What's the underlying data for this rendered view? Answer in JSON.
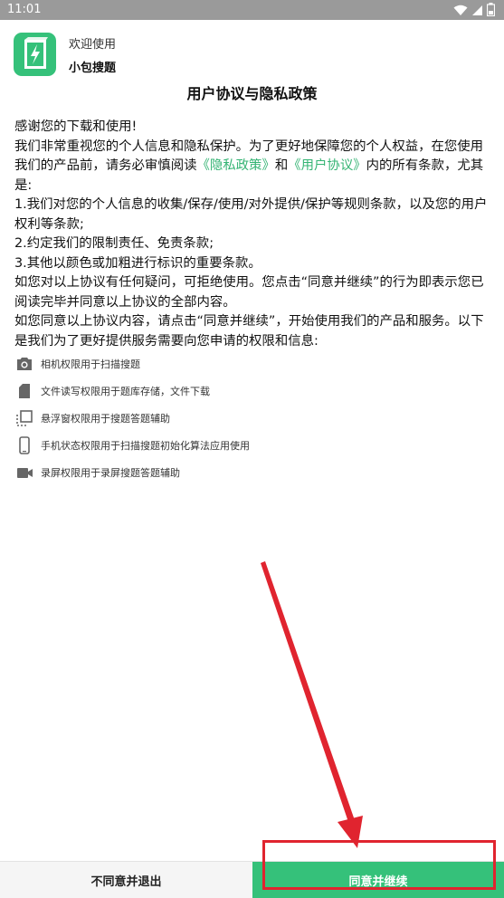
{
  "status_bar": {
    "time": "11:01",
    "icons": [
      "wifi-icon",
      "signal-icon",
      "battery-icon"
    ]
  },
  "header": {
    "welcome": "欢迎使用",
    "app_name": "小包搜题",
    "logo_icon": "book-lightning-logo"
  },
  "dialog": {
    "title": "用户协议与隐私政策",
    "para1": "感谢您的下载和使用!",
    "para2_pre": "我们非常重视您的个人信息和隐私保护。为了更好地保障您的个人权益，在您使用我们的产品前，请务必审慎阅读",
    "privacy_link": "《隐私政策》",
    "para2_and": "和",
    "terms_link": "《用户协议》",
    "para2_post": "内的所有条款，尤其是:",
    "item1": " 1.我们对您的个人信息的收集/保存/使用/对外提供/保护等规则条款，以及您的用户权利等条款;",
    "item2": " 2.约定我们的限制责任、免责条款;",
    "item3": " 3.其他以颜色或加粗进行标识的重要条款。",
    "para3": " 如您对以上协议有任何疑问，可拒绝使用。您点击“同意并继续”的行为即表示您已阅读完毕并同意以上协议的全部内容。",
    "para4": " 如您同意以上协议内容，请点击“同意并继续”，开始使用我们的产品和服务。以下是我们为了更好提供服务需要向您申请的权限和信息:"
  },
  "permissions": [
    {
      "icon": "camera-icon",
      "label": "相机权限用于扫描搜题"
    },
    {
      "icon": "sd-card-icon",
      "label": "文件读写权限用于题库存储，文件下载"
    },
    {
      "icon": "floating-window-icon",
      "label": "悬浮窗权限用于搜题答题辅助"
    },
    {
      "icon": "phone-icon",
      "label": "手机状态权限用于扫描搜题初始化算法应用使用"
    },
    {
      "icon": "video-camera-icon",
      "label": "录屏权限用于录屏搜题答题辅助"
    }
  ],
  "buttons": {
    "decline": "不同意并退出",
    "agree": "同意并继续"
  },
  "colors": {
    "accent": "#35c17a",
    "link": "#35b474",
    "annotation": "#e0242f",
    "status_bar": "#9a9a9a"
  }
}
